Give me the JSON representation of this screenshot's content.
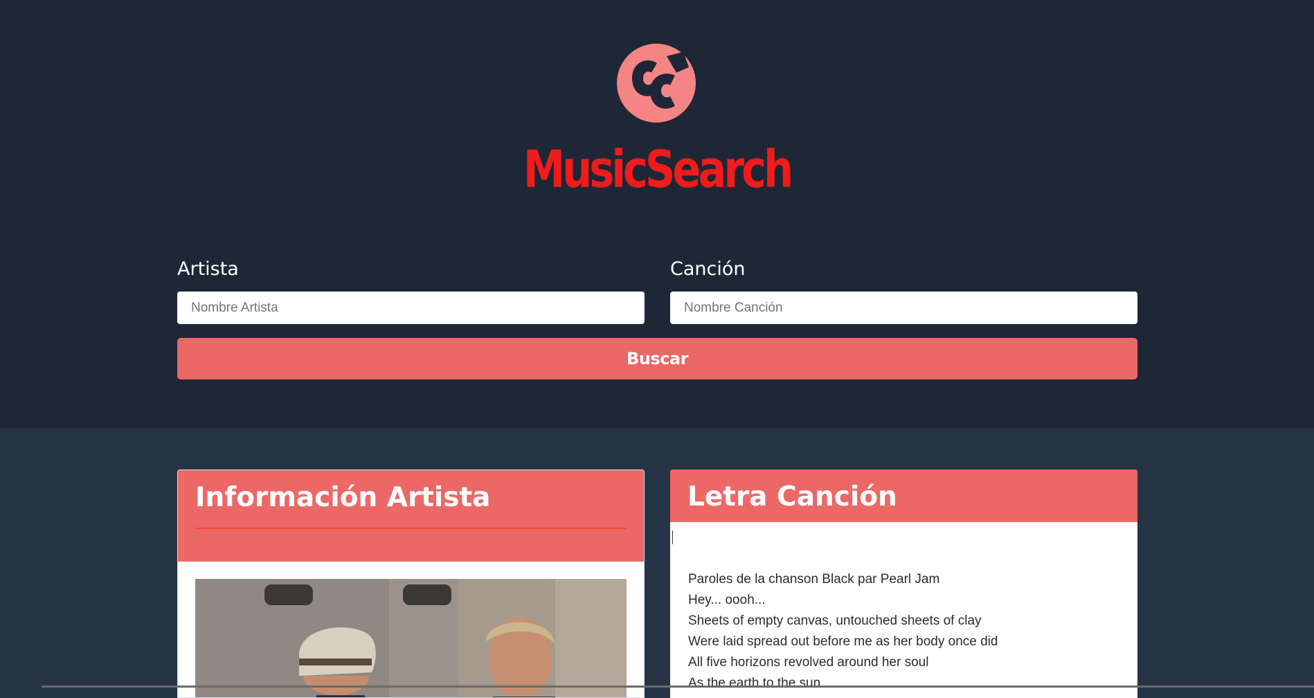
{
  "header": {
    "brand": "MusicSearch",
    "logo_icon": "music-search-logo-icon"
  },
  "search": {
    "artist_label": "Artista",
    "artist_placeholder": "Nombre Artista",
    "artist_value": "",
    "song_label": "Canción",
    "song_placeholder": "Nombre Canción",
    "song_value": "",
    "button_label": "Buscar"
  },
  "artist_card": {
    "title": "Información Artista"
  },
  "lyrics_card": {
    "title": "Letra Canción",
    "lines": [
      "Paroles de la chanson Black par Pearl Jam",
      "Hey... oooh...",
      "Sheets of empty canvas, untouched sheets of clay",
      "Were laid spread out before me as her body once did",
      "All five horizons revolved around her soul",
      "As the earth to the sun"
    ]
  },
  "colors": {
    "hero_bg": "#1e2736",
    "page_bg": "#263445",
    "accent": "#ec6866",
    "brand_red": "#f11b1b",
    "logo_pink": "#f58585"
  }
}
